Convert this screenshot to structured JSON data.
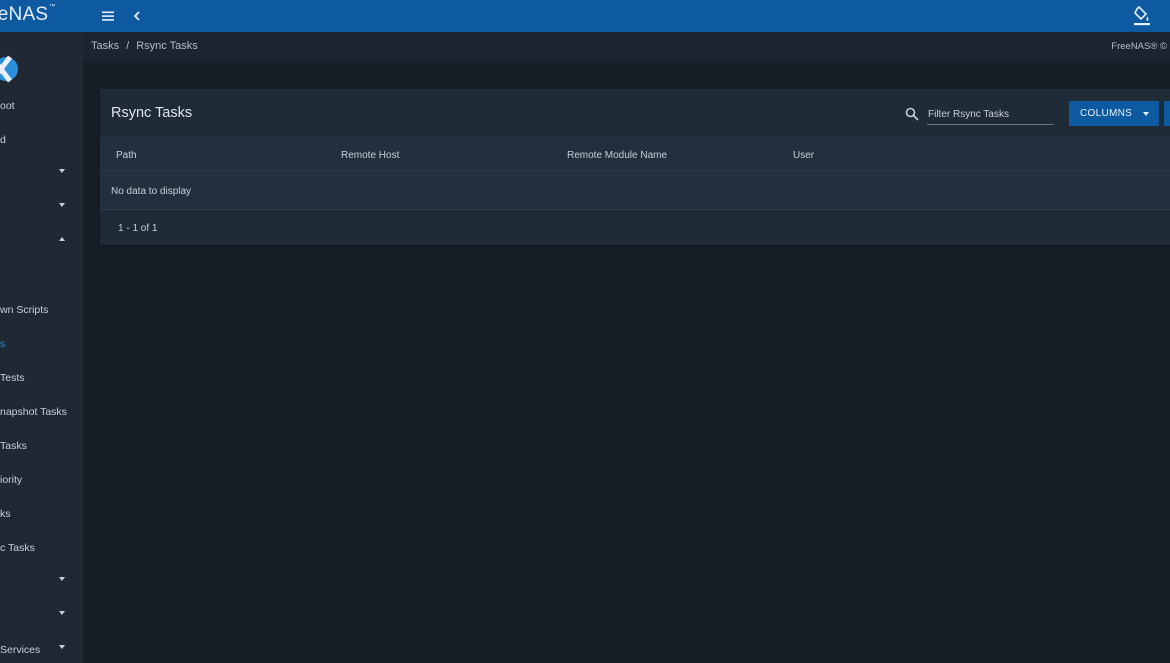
{
  "app": {
    "brand_name": "FreeNAS",
    "brand_visible": "eeNAS",
    "brand_tm": "™",
    "copyright": "FreeNAS® ©"
  },
  "topbar": {
    "menu_icon": "menu-icon",
    "back_icon": "chevron-left-icon",
    "theme_icon": "paint-bucket-icon",
    "color": "#0d5aa0"
  },
  "breadcrumb": {
    "parent": "Tasks",
    "separator": "/",
    "current": "Rsync Tasks"
  },
  "sidebar": {
    "items": [
      {
        "label": "oot"
      },
      {
        "label": "d"
      },
      {
        "label": "",
        "caret": "down"
      },
      {
        "label": "",
        "caret": "down"
      },
      {
        "label": "",
        "caret": "up"
      },
      {
        "label": ""
      },
      {
        "label": "wn Scripts"
      },
      {
        "label": "s",
        "active": true
      },
      {
        "label": "Tests"
      },
      {
        "label": "napshot Tasks"
      },
      {
        "label": "Tasks"
      },
      {
        "label": "iority"
      },
      {
        "label": "ks"
      },
      {
        "label": "c Tasks"
      },
      {
        "label": "",
        "caret": "down"
      },
      {
        "label": "",
        "caret": "down"
      },
      {
        "label": "Services",
        "caret": "down"
      }
    ],
    "active_color": "#2b90dc"
  },
  "card": {
    "title": "Rsync Tasks",
    "filter_placeholder": "Filter Rsync Tasks",
    "filter_value": "",
    "columns_button": "COLUMNS",
    "headers": [
      "Path",
      "Remote Host",
      "Remote Module Name",
      "User"
    ],
    "empty_message": "No data to display",
    "pagination": "1 - 1 of 1"
  }
}
